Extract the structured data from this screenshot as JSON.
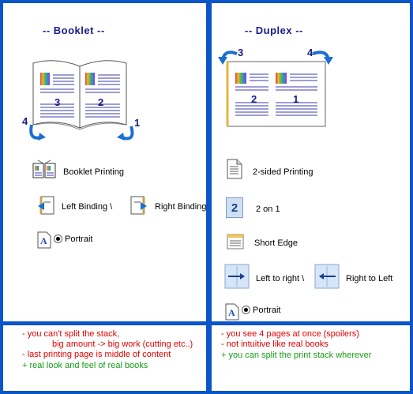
{
  "booklet": {
    "title": "-- Booklet --",
    "page_left": "3",
    "page_right": "2",
    "arrow_left_num": "4",
    "arrow_right_num": "1",
    "printing_label": "Booklet Printing",
    "left_binding_label": "Left Binding \\",
    "right_binding_label": "Right Binding",
    "orientation_label": "Portrait"
  },
  "duplex": {
    "title": "-- Duplex --",
    "page_left": "2",
    "page_right": "1",
    "arrow_left_num": "3",
    "arrow_right_num": "4",
    "sided_label": "2-sided Printing",
    "two_on_one_label": "2 on 1",
    "two_on_one_icon_num": "2",
    "short_edge_label": "Short Edge",
    "ltr_label": "Left to right \\",
    "rtl_label": "Right to Left",
    "orientation_label": "Portrait"
  },
  "notes_booklet": [
    {
      "text": "- you can't split the stack,",
      "kind": "con"
    },
    {
      "text": "big amount -> big work (cutting etc..)",
      "kind": "con"
    },
    {
      "text": "- last printing page is middle of content",
      "kind": "con"
    },
    {
      "text": "+ real look and feel of real books",
      "kind": "pro"
    }
  ],
  "notes_duplex": [
    {
      "text": "- you see 4 pages at once (spoilers)",
      "kind": "con"
    },
    {
      "text": "- not intuitive like real books",
      "kind": "con"
    },
    {
      "text": "+ you can split the print stack wherever",
      "kind": "pro"
    }
  ],
  "colors": {
    "background_blue": "#0a55c8",
    "title_navy": "#1a1a8c",
    "con_red": "#e00000",
    "pro_green": "#159d15",
    "arrow_blue": "#1b6fd1"
  },
  "icons": [
    "booklet-printing-icon",
    "left-binding-icon",
    "right-binding-icon",
    "portrait-icon",
    "two-sided-printing-icon",
    "two-on-one-icon",
    "short-edge-icon",
    "left-to-right-icon",
    "right-to-left-icon"
  ]
}
